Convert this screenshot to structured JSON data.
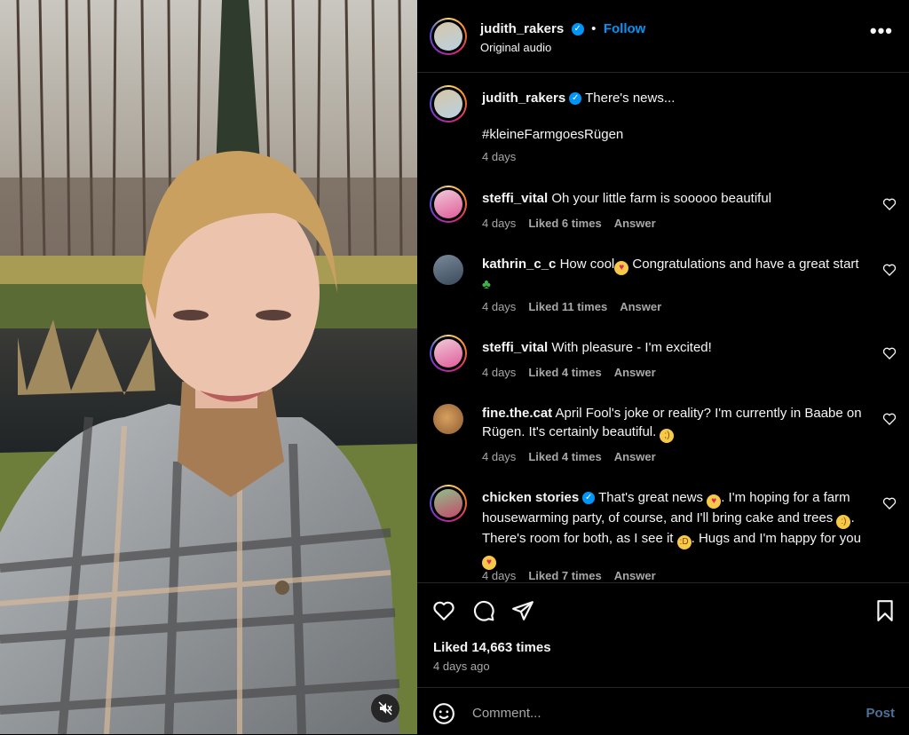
{
  "post": {
    "author": "judith_rakers",
    "follow_label": "Follow",
    "audio": "Original audio",
    "more_label": "•••",
    "caption": {
      "username": "judith_rakers",
      "text": "There's news...",
      "hashtag": "#kleineFarmgoesRügen",
      "time": "4 days"
    }
  },
  "comments": [
    {
      "username": "steffi_vital",
      "verified": false,
      "text": "Oh your little farm is sooooo beautiful",
      "time": "4 days",
      "likes": "Liked 6 times",
      "answer": "Answer"
    },
    {
      "username": "kathrin_c_c",
      "verified": false,
      "text_a": "How cool",
      "text_b": " Congratulations and have a great start",
      "time": "4 days",
      "likes": "Liked 11 times",
      "answer": "Answer"
    },
    {
      "username": "steffi_vital",
      "verified": false,
      "text": "With pleasure - I'm excited!",
      "time": "4 days",
      "likes": "Liked 4 times",
      "answer": "Answer"
    },
    {
      "username": "fine.the.cat",
      "verified": false,
      "text": "April Fool's joke or reality? I'm currently in Baabe on Rügen. It's certainly beautiful.",
      "time": "4 days",
      "likes": "Liked 4 times",
      "answer": "Answer"
    },
    {
      "username": "chicken stories",
      "verified": true,
      "text_a": "That's great news",
      "text_b": ". I'm hoping for a farm housewarming party, of course, and I'll bring cake and trees",
      "text_c": ". There's room for both, as I see it",
      "text_d": ". Hugs and I'm happy for you",
      "time": "4 days",
      "likes": "Liked 7 times",
      "answer": "Answer"
    }
  ],
  "footer": {
    "likes": "Liked 14,663 times",
    "time_ago": "4 days ago",
    "comment_placeholder": "Comment...",
    "post_label": "Post"
  },
  "colors": {
    "accent": "#0095f6",
    "background": "#000000",
    "muted": "#a8a8a8",
    "post_disabled": "#4e7196"
  },
  "icons": [
    "heart-icon",
    "comment-icon",
    "share-icon",
    "bookmark-icon",
    "emoji-icon",
    "mute-icon",
    "verified-icon",
    "more-icon"
  ]
}
